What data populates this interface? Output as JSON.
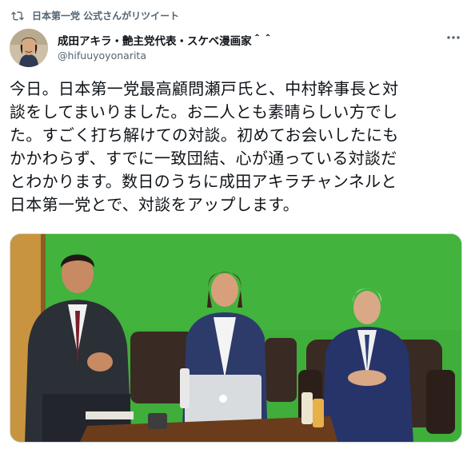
{
  "retweet": {
    "icon": "retweet-icon",
    "label": "日本第一党 公式さんがリツイート"
  },
  "author": {
    "display_name": "成田アキラ・艶主党代表・スケベ漫画家＾＾",
    "handle": "@hifuuyoyonarita",
    "avatar": "avatar-photo"
  },
  "tweet": {
    "text": "今日。日本第一党最高顧問瀬戸氏と、中村幹事長と対\n談をしてまいりました。お二人とも素晴らしい方でし\nた。すごく打ち解けての対談。初めてお会いしたにも\nかかわらず、すでに一致団結、心が通っている対談だ\nとわかります。数日のうちに成田アキラチャンネルと\n日本第一党とで、対談をアップします。"
  },
  "more_icon": "more-horizontal-icon",
  "media": {
    "type": "photo",
    "description_icon": "photo-of-three-men-on-green-screen"
  },
  "colors": {
    "text": "#0f1419",
    "secondary": "#536471",
    "green_screen": "#3aa63a"
  }
}
